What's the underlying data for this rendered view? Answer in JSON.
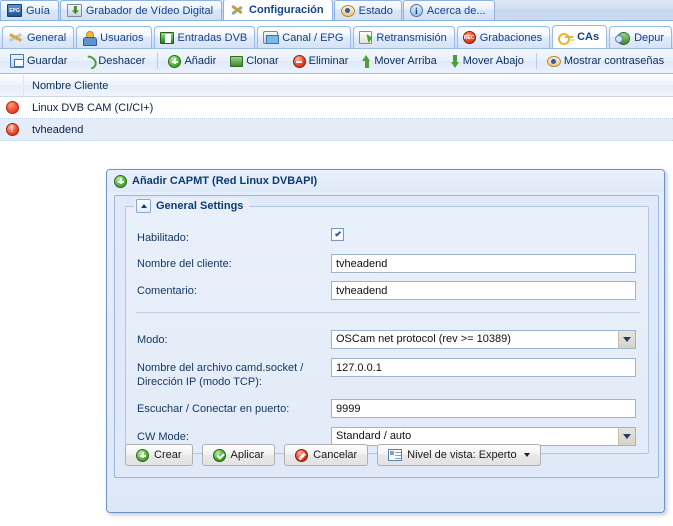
{
  "top_tabs": [
    {
      "label": "Guía",
      "icon": "epg-icon",
      "active": false
    },
    {
      "label": "Grabador de Vídeo Digital",
      "icon": "dvr-icon",
      "active": false
    },
    {
      "label": "Configuración",
      "icon": "wrench-icon",
      "active": true
    },
    {
      "label": "Estado",
      "icon": "eye-icon",
      "active": false
    },
    {
      "label": "Acerca de...",
      "icon": "info-icon",
      "active": false
    }
  ],
  "sub_tabs": [
    {
      "label": "General",
      "icon": "tools-icon",
      "active": false
    },
    {
      "label": "Usuarios",
      "icon": "users-icon",
      "active": false
    },
    {
      "label": "Entradas DVB",
      "icon": "dvb-card-icon",
      "active": false
    },
    {
      "label": "Canal / EPG",
      "icon": "tv-icon",
      "active": false
    },
    {
      "label": "Retransmisión",
      "icon": "stream-icon",
      "active": false
    },
    {
      "label": "Grabaciones",
      "icon": "record-icon",
      "active": false
    },
    {
      "label": "CAs",
      "icon": "key-icon",
      "active": true
    },
    {
      "label": "Depur",
      "icon": "bug-icon",
      "active": false
    }
  ],
  "toolbar": [
    {
      "label": "Guardar",
      "icon": "save-icon"
    },
    {
      "label": "Deshacer",
      "icon": "undo-icon"
    },
    {
      "label": "Añadir",
      "icon": "plus-circle-icon"
    },
    {
      "label": "Clonar",
      "icon": "clone-icon"
    },
    {
      "label": "Eliminar",
      "icon": "minus-circle-icon"
    },
    {
      "label": "Mover Arriba",
      "icon": "arrow-up-icon"
    },
    {
      "label": "Mover Abajo",
      "icon": "arrow-down-icon"
    },
    {
      "label": "Mostrar contraseñas",
      "icon": "eye-icon"
    }
  ],
  "grid": {
    "columns": [
      "Nombre Cliente"
    ],
    "rows": [
      {
        "status_icon": "red-dot-icon",
        "name": "Linux DVB CAM (CI/CI+)"
      },
      {
        "status_icon": "red-alert-icon",
        "name": "tvheadend"
      }
    ]
  },
  "dialog": {
    "title": "Añadir CAPMT (Red Linux DVBAPI)",
    "title_icon": "plus-circle-icon",
    "fieldset_legend": "General Settings",
    "fields": {
      "enabled_label": "Habilitado:",
      "enabled_checked": true,
      "client_name_label": "Nombre del cliente:",
      "client_name_value": "tvheadend",
      "comment_label": "Comentario:",
      "comment_value": "tvheadend",
      "mode_label": "Modo:",
      "mode_value": "OSCam net protocol (rev >= 10389)",
      "camd_socket_label": "Nombre del archivo camd.socket / Dirección IP (modo TCP):",
      "camd_socket_value": "127.0.0.1",
      "port_label": "Escuchar / Conectar en puerto:",
      "port_value": "9999",
      "cw_mode_label": "CW Mode:",
      "cw_mode_value": "Standard / auto"
    },
    "buttons": [
      {
        "label": "Crear",
        "icon": "plus-circle-icon"
      },
      {
        "label": "Aplicar",
        "icon": "check-circle-icon"
      },
      {
        "label": "Cancelar",
        "icon": "deny-icon"
      },
      {
        "label": "Nivel de vista: Experto",
        "icon": "list-icon",
        "has_caret": true
      }
    ]
  },
  "colors": {
    "accent": "#15428b",
    "tab_border": "#99bbe8",
    "dialog_bg": "#dfe9f7",
    "selected_row": "#e4ecf8"
  }
}
